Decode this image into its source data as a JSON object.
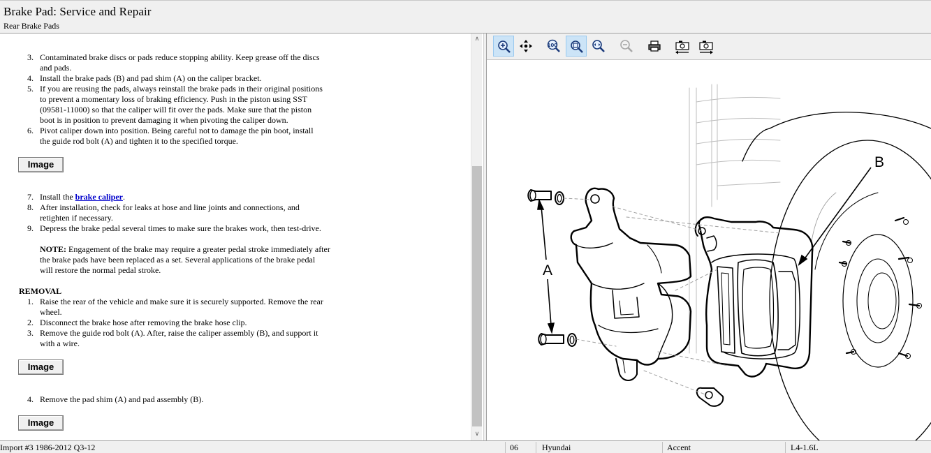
{
  "header": {
    "title": "Brake Pad:  Service and Repair",
    "subtitle": "Rear Brake Pads"
  },
  "steps_a": [
    {
      "num": "3.",
      "lines": [
        "Contaminated brake discs or pads reduce stopping ability. Keep grease off the discs",
        "and pads."
      ]
    },
    {
      "num": "4.",
      "lines": [
        "Install the brake pads (B) and pad shim (A) on the caliper bracket."
      ]
    },
    {
      "num": "5.",
      "lines": [
        "If you are reusing the pads, always reinstall the brake pads in their original positions",
        "to prevent a momentary loss of braking efficiency. Push in the piston using SST",
        "(09581-11000) so that the caliper will fit over the pads. Make sure that the piston",
        "boot is in position to prevent damaging it when pivoting the caliper down."
      ]
    },
    {
      "num": "6.",
      "lines": [
        "Pivot caliper down into position. Being careful not to damage the pin boot, install",
        "the guide rod bolt (A) and tighten it to the specified torque."
      ]
    }
  ],
  "image_button_label": "Image",
  "step7": {
    "num": "7.",
    "prefix": "Install the ",
    "link": "brake caliper",
    "suffix": "."
  },
  "steps_b": [
    {
      "num": "8.",
      "lines": [
        "After installation, check for leaks at hose and line joints and connections, and",
        "retighten if necessary."
      ]
    },
    {
      "num": "9.",
      "lines": [
        "Depress the brake pedal several times to make sure the brakes work, then test-drive."
      ]
    }
  ],
  "note": {
    "label": "NOTE:",
    "lines": [
      " Engagement of the brake may require a greater pedal stroke immediately after",
      "the brake pads have been replaced as a set. Several applications of the brake pedal",
      "will restore the normal pedal stroke."
    ]
  },
  "removal_heading": "REMOVAL",
  "removal_steps": [
    {
      "num": "1.",
      "lines": [
        "Raise the rear of the vehicle and make sure it is securely supported. Remove the rear",
        "wheel."
      ]
    },
    {
      "num": "2.",
      "lines": [
        "Disconnect the brake hose after removing the brake hose clip."
      ]
    },
    {
      "num": "3.",
      "lines": [
        "Remove the guide rod bolt (A). After, raise the caliper assembly (B), and support it",
        "with a wire."
      ]
    }
  ],
  "removal_step4": {
    "num": "4.",
    "lines": [
      "Remove the pad shim (A) and pad assembly (B)."
    ]
  },
  "diagram": {
    "label_a": "A",
    "label_b": "B"
  },
  "toolbar": {
    "buttons": [
      "zoom-in",
      "pan",
      "actual-size",
      "fit-window",
      "fit-width",
      "zoom-out",
      "print",
      "previous-image",
      "next-image"
    ]
  },
  "status": {
    "source": "Import #3 1986-2012 Q3-12",
    "year": "06",
    "make": "Hyundai",
    "model": "Accent",
    "engine": "L4-1.6L"
  }
}
